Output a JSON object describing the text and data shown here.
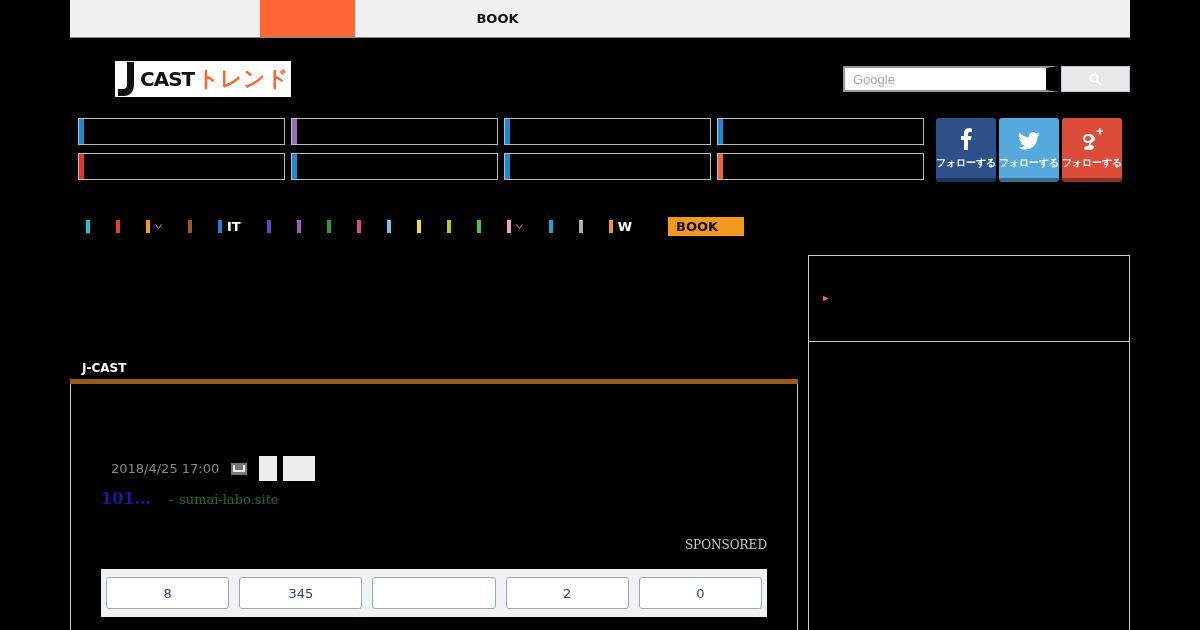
{
  "top_nav": [
    {
      "selected": true
    },
    {
      "label": "BOOK",
      "selected": false
    }
  ],
  "logo": {
    "brand": "CAST",
    "sub": "トレンド"
  },
  "search": {
    "placeholder": "Google"
  },
  "categories": [
    {
      "color": "#1e88d0"
    },
    {
      "color": "#9b6fb5"
    },
    {
      "color": "#1e88d0"
    },
    {
      "color": "#1e88d0"
    },
    {
      "color": "#e0352b"
    },
    {
      "color": "#1e88d0"
    },
    {
      "color": "#1e88d0"
    },
    {
      "color": "#f0643a"
    }
  ],
  "social": [
    {
      "kind": "facebook",
      "label": "フォローする"
    },
    {
      "kind": "twitter",
      "label": "フォローする"
    },
    {
      "kind": "google",
      "label": "フォローする"
    }
  ],
  "nav": [
    {
      "color": "#20c4d0"
    },
    {
      "color": "#e0452b"
    },
    {
      "color": "#f09a20",
      "dropdown": true
    },
    {
      "color": "#9a5a2a"
    },
    {
      "color": "#2a7ad8",
      "label": "IT"
    },
    {
      "color": "#5a4ac0"
    },
    {
      "color": "#a060b8"
    },
    {
      "color": "#2a9a3a"
    },
    {
      "color": "#e04a7a"
    },
    {
      "color": "#70c8f0"
    },
    {
      "color": "#f0e020"
    },
    {
      "color": "#b0d020"
    },
    {
      "color": "#60c030"
    },
    {
      "color": "#f0a0d0",
      "dropdown": true
    },
    {
      "color": "#1ea0d8"
    },
    {
      "color": "#b0b0b0"
    },
    {
      "color": "#f09a20",
      "label": "W"
    }
  ],
  "nav_button": "BOOK",
  "section_title": "J-CAST",
  "article": {
    "date": "2018/4/25 17:00",
    "link": "101...",
    "separator": "-",
    "source": "sumai-labo.site",
    "sponsored": "SPONSORED"
  },
  "counts": [
    {
      "kind": "count",
      "value": "8"
    },
    {
      "kind": "count",
      "value": "345"
    },
    {
      "kind": "blank"
    },
    {
      "kind": "count",
      "value": "2"
    },
    {
      "kind": "count",
      "value": "0"
    }
  ]
}
